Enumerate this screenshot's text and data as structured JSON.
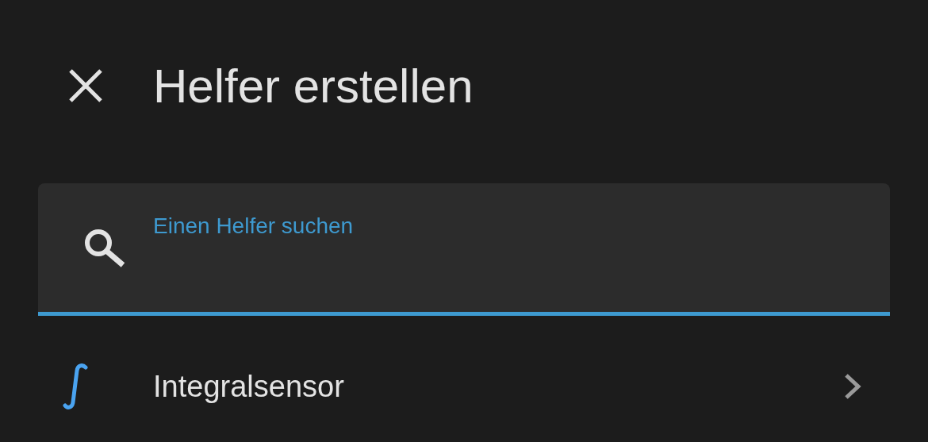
{
  "title": "Helfer erstellen",
  "search": {
    "label": "Einen Helfer suchen",
    "focused": true
  },
  "items": [
    {
      "label": "Integralsensor"
    }
  ]
}
